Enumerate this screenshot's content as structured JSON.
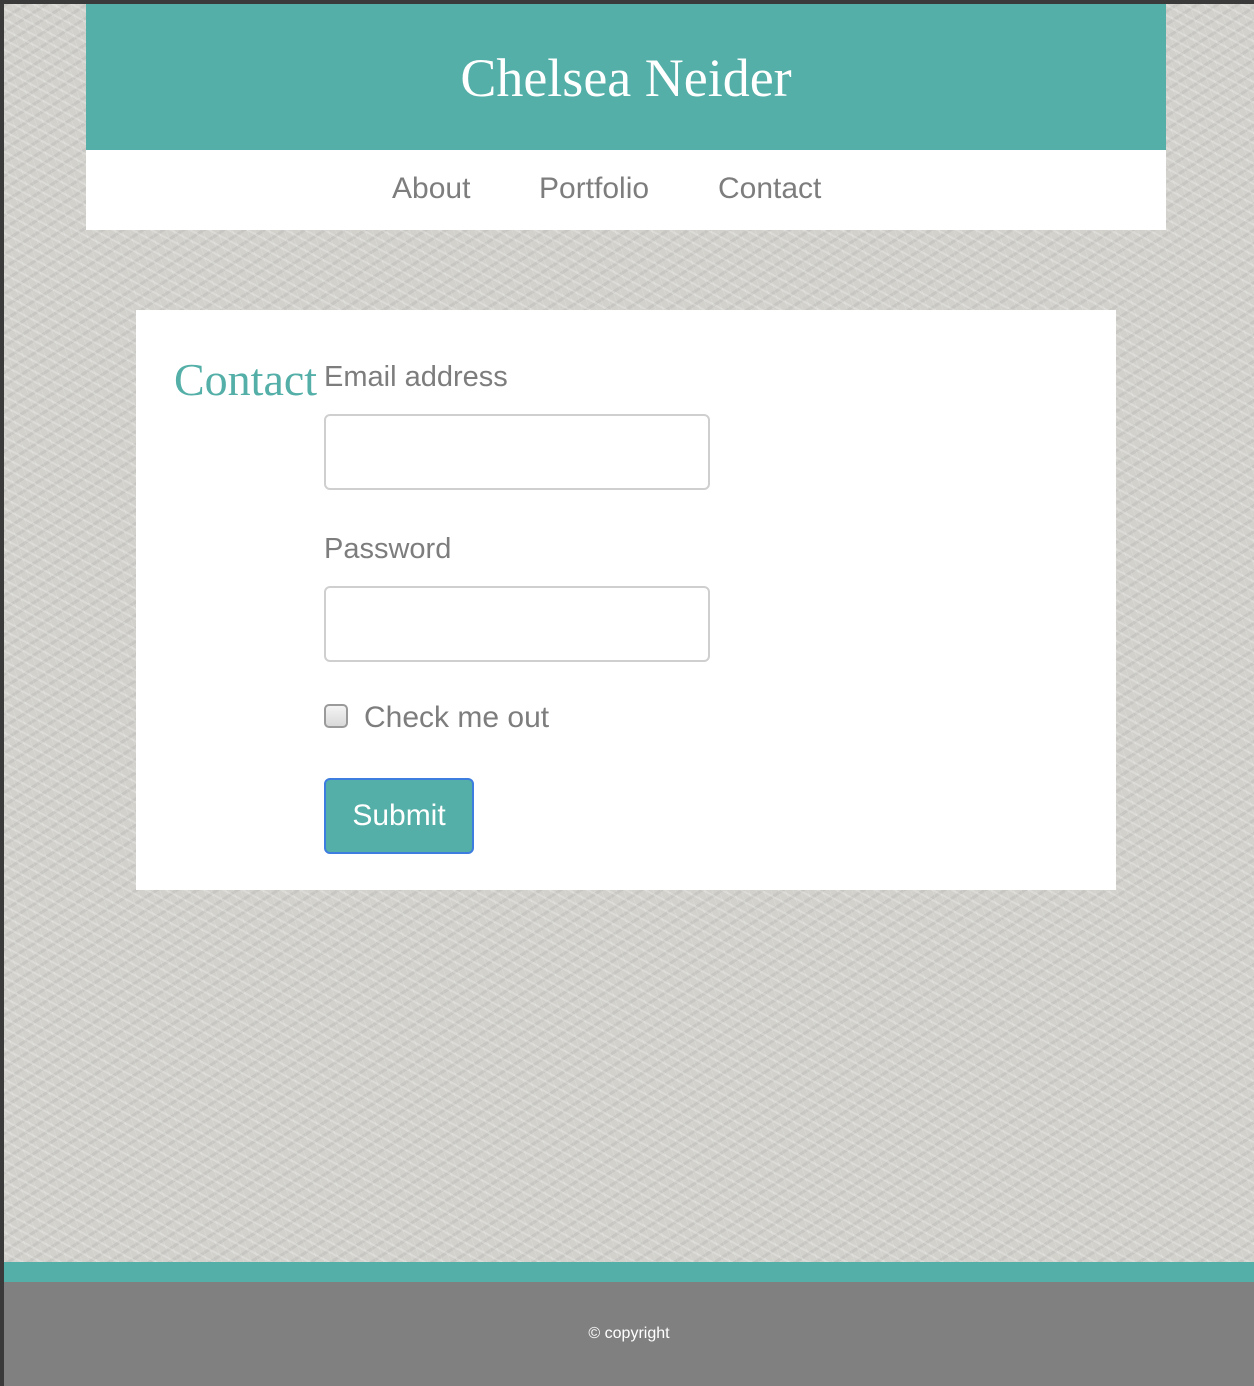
{
  "header": {
    "site_title": "Chelsea Neider"
  },
  "nav": {
    "items": [
      {
        "label": "About"
      },
      {
        "label": "Portfolio"
      },
      {
        "label": "Contact"
      }
    ]
  },
  "contact": {
    "heading": "Contact",
    "email_label": "Email address",
    "email_value": "",
    "password_label": "Password",
    "password_value": "",
    "checkbox_label": "Check me out",
    "checkbox_checked": false,
    "submit_label": "Submit"
  },
  "footer": {
    "copyright": "© copyright"
  },
  "colors": {
    "accent": "#53afa7",
    "footer_bg": "#808080",
    "text_gray": "#7d7d7d",
    "focus_border": "#3d7de0"
  }
}
